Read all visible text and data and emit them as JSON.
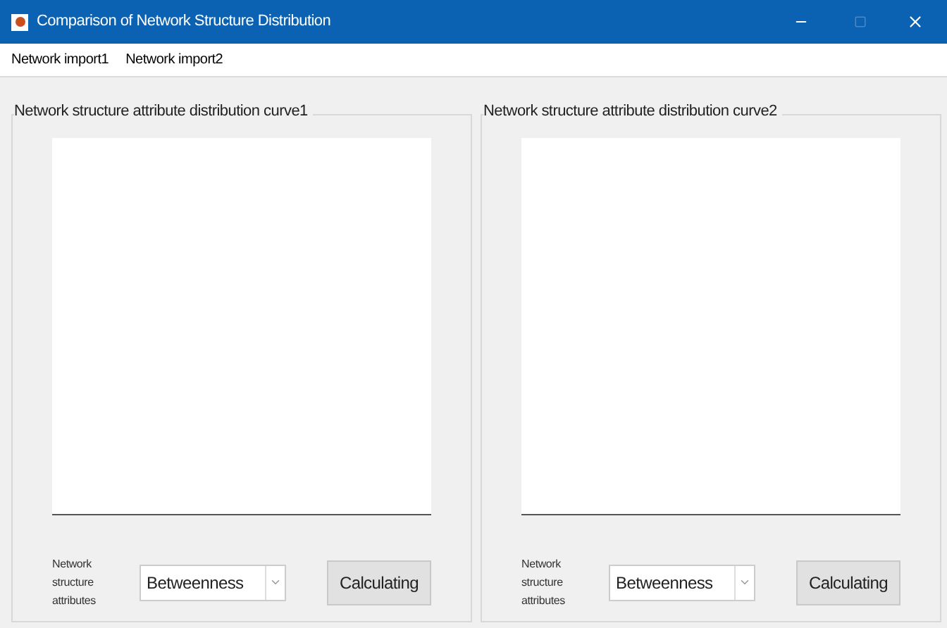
{
  "window": {
    "title": "Comparison of Network Structure Distribution"
  },
  "menu": [
    "Network import1",
    "Network import2"
  ],
  "panels": [
    {
      "title": "Network structure attribute distribution curve1",
      "attribute_label": "Network structure attributes",
      "dropdown": {
        "value": "Betweenness"
      },
      "button": "Calculating"
    },
    {
      "title": "Network structure attribute distribution curve2",
      "attribute_label": "Network structure attributes",
      "dropdown": {
        "value": "Betweenness"
      },
      "button": "Calculating"
    }
  ]
}
